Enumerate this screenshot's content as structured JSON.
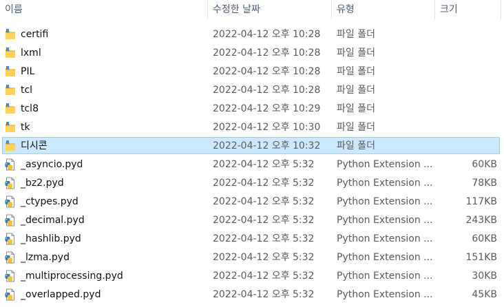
{
  "columns": {
    "name": "이름",
    "modified": "수정한 날짜",
    "type": "유형",
    "size": "크기"
  },
  "rows": [
    {
      "name": "certifi",
      "modified": "2022-04-12 오후 10:28",
      "type": "파일 폴더",
      "size": "",
      "kind": "folder",
      "selected": false
    },
    {
      "name": "lxml",
      "modified": "2022-04-12 오후 10:28",
      "type": "파일 폴더",
      "size": "",
      "kind": "folder",
      "selected": false
    },
    {
      "name": "PIL",
      "modified": "2022-04-12 오후 10:28",
      "type": "파일 폴더",
      "size": "",
      "kind": "folder",
      "selected": false
    },
    {
      "name": "tcl",
      "modified": "2022-04-12 오후 10:28",
      "type": "파일 폴더",
      "size": "",
      "kind": "folder",
      "selected": false
    },
    {
      "name": "tcl8",
      "modified": "2022-04-12 오후 10:29",
      "type": "파일 폴더",
      "size": "",
      "kind": "folder",
      "selected": false
    },
    {
      "name": "tk",
      "modified": "2022-04-12 오후 10:30",
      "type": "파일 폴더",
      "size": "",
      "kind": "folder",
      "selected": false
    },
    {
      "name": "디시콘",
      "modified": "2022-04-12 오후 10:32",
      "type": "파일 폴더",
      "size": "",
      "kind": "folder",
      "selected": true
    },
    {
      "name": "_asyncio.pyd",
      "modified": "2022-04-12 오후 5:32",
      "type": "Python Extension ...",
      "size": "60KB",
      "kind": "pyd",
      "selected": false
    },
    {
      "name": "_bz2.pyd",
      "modified": "2022-04-12 오후 5:32",
      "type": "Python Extension ...",
      "size": "78KB",
      "kind": "pyd",
      "selected": false
    },
    {
      "name": "_ctypes.pyd",
      "modified": "2022-04-12 오후 5:32",
      "type": "Python Extension ...",
      "size": "117KB",
      "kind": "pyd",
      "selected": false
    },
    {
      "name": "_decimal.pyd",
      "modified": "2022-04-12 오후 5:32",
      "type": "Python Extension ...",
      "size": "243KB",
      "kind": "pyd",
      "selected": false
    },
    {
      "name": "_hashlib.pyd",
      "modified": "2022-04-12 오후 5:32",
      "type": "Python Extension ...",
      "size": "60KB",
      "kind": "pyd",
      "selected": false
    },
    {
      "name": "_lzma.pyd",
      "modified": "2022-04-12 오후 5:32",
      "type": "Python Extension ...",
      "size": "151KB",
      "kind": "pyd",
      "selected": false
    },
    {
      "name": "_multiprocessing.pyd",
      "modified": "2022-04-12 오후 5:32",
      "type": "Python Extension ...",
      "size": "30KB",
      "kind": "pyd",
      "selected": false
    },
    {
      "name": "_overlapped.pyd",
      "modified": "2022-04-12 오후 5:32",
      "type": "Python Extension ...",
      "size": "45KB",
      "kind": "pyd",
      "selected": false
    }
  ]
}
